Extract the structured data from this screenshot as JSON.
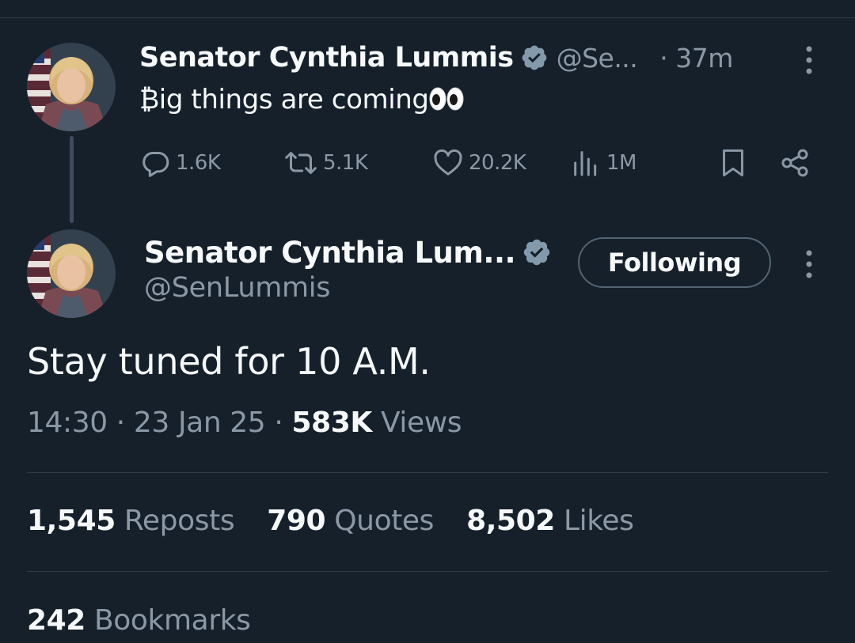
{
  "parent_tweet": {
    "author_name": "Senator Cynthia Lummis",
    "handle": "@Se...",
    "separator": "·",
    "time": "37m",
    "text": "₿ig things are coming",
    "emoji": "eyes",
    "actions": {
      "replies": "1.6K",
      "reposts": "5.1K",
      "likes": "20.2K",
      "views": "1M"
    }
  },
  "main_tweet": {
    "author_name": "Senator Cynthia Lum...",
    "handle": "@SenLummis",
    "follow_label": "Following",
    "text": "Stay tuned for 10 A.M.",
    "time": "14:30",
    "date": "23 Jan 25",
    "separator": "·",
    "views_count": "583K",
    "views_label": "Views",
    "stats": {
      "reposts_count": "1,545",
      "reposts_label": "Reposts",
      "quotes_count": "790",
      "quotes_label": "Quotes",
      "likes_count": "8,502",
      "likes_label": "Likes",
      "bookmarks_count": "242",
      "bookmarks_label": "Bookmarks"
    }
  },
  "colors": {
    "background": "#15202b",
    "text_primary": "#f7f9f9",
    "text_secondary": "#8b98a5",
    "divider": "#2f3b47",
    "verified_badge": "#829aab"
  },
  "icons": {
    "verified": "verified-badge-icon",
    "more": "more-vertical-icon",
    "reply": "reply-bubble-icon",
    "repost": "repost-icon",
    "like": "heart-icon",
    "views": "analytics-bars-icon",
    "bookmark": "bookmark-icon",
    "share": "share-icon"
  }
}
